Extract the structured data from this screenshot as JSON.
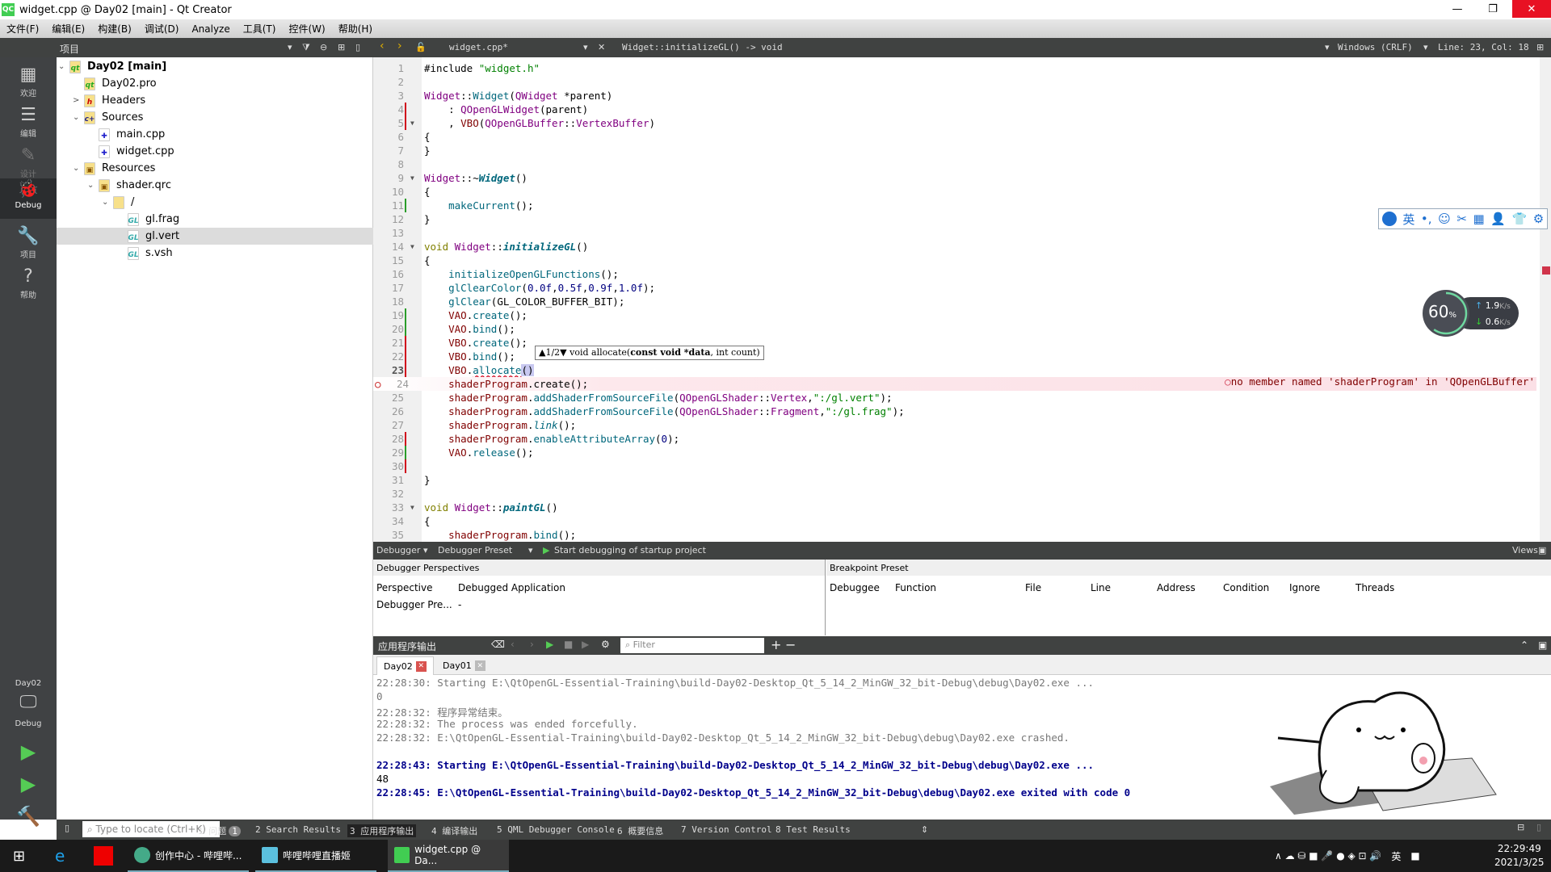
{
  "window": {
    "title": "widget.cpp @ Day02 [main] - Qt Creator",
    "logo": "QC"
  },
  "menu": [
    "文件(F)",
    "编辑(E)",
    "构建(B)",
    "调试(D)",
    "Analyze",
    "工具(T)",
    "控件(W)",
    "帮助(H)"
  ],
  "toolbar": {
    "projects_label": "项目",
    "file": "widget.cpp*",
    "symbol": "Widget::initializeGL() -> void",
    "encoding": "Windows (CRLF)",
    "position": "Line: 23, Col: 18"
  },
  "modes": [
    {
      "label": "欢迎",
      "icon": "grid-icon"
    },
    {
      "label": "编辑",
      "icon": "edit-icon"
    },
    {
      "label": "设计",
      "icon": "pencil-icon"
    },
    {
      "label": "Debug",
      "icon": "bug-icon"
    },
    {
      "label": "项目",
      "icon": "wrench-icon"
    },
    {
      "label": "帮助",
      "icon": "help-icon"
    }
  ],
  "kit": {
    "project": "Day02",
    "mode": "Debug"
  },
  "tree": [
    {
      "label": "Day02 [main]",
      "depth": 0,
      "chev": "v",
      "icon": "qt",
      "bold": true
    },
    {
      "label": "Day02.pro",
      "depth": 1,
      "chev": "",
      "icon": "qt"
    },
    {
      "label": "Headers",
      "depth": 1,
      "chev": ">",
      "icon": "h"
    },
    {
      "label": "Sources",
      "depth": 1,
      "chev": "v",
      "icon": "c++"
    },
    {
      "label": "main.cpp",
      "depth": 2,
      "chev": "",
      "icon": "cpp"
    },
    {
      "label": "widget.cpp",
      "depth": 2,
      "chev": "",
      "icon": "cpp"
    },
    {
      "label": "Resources",
      "depth": 1,
      "chev": "v",
      "icon": "res"
    },
    {
      "label": "shader.qrc",
      "depth": 2,
      "chev": "v",
      "icon": "res"
    },
    {
      "label": "/",
      "depth": 3,
      "chev": "v",
      "icon": "folder"
    },
    {
      "label": "gl.frag",
      "depth": 4,
      "chev": "",
      "icon": "gl"
    },
    {
      "label": "gl.vert",
      "depth": 4,
      "chev": "",
      "icon": "gl",
      "selected": true
    },
    {
      "label": "s.vsh",
      "depth": 4,
      "chev": "",
      "icon": "gl"
    }
  ],
  "editor": {
    "current_line": 23,
    "breakpoint_line": 24,
    "error_line": 24,
    "error_message": "no member named 'shaderProgram' in 'QOpenGLBuffer'",
    "tooltip": {
      "counter": "1/2",
      "prefix": "void allocate(",
      "bold": "const void *data",
      "suffix": ", int count)"
    },
    "changed_red": [
      4,
      5,
      21,
      22,
      23,
      28,
      30
    ],
    "changed_green": [
      11,
      19,
      20,
      29
    ],
    "folds": [
      5,
      9,
      14,
      33
    ],
    "lines": [
      [
        [
          "#include ",
          ""
        ],
        [
          "\"widget.h\"",
          "s"
        ]
      ],
      [],
      [
        [
          "Widget",
          "ty"
        ],
        [
          "::",
          ""
        ],
        [
          "Widget",
          "f"
        ],
        [
          "(",
          ""
        ],
        [
          "QWidget",
          "ty"
        ],
        [
          " *parent)",
          ""
        ]
      ],
      [
        [
          "    : ",
          ""
        ],
        [
          "QOpenGLWidget",
          "ty"
        ],
        [
          "(parent)",
          ""
        ]
      ],
      [
        [
          "    , ",
          ""
        ],
        [
          "VBO",
          "m"
        ],
        [
          "(",
          ""
        ],
        [
          "QOpenGLBuffer",
          "ty"
        ],
        [
          "::",
          ""
        ],
        [
          "VertexBuffer",
          "ty"
        ],
        [
          ")",
          ""
        ]
      ],
      [
        [
          "{",
          ""
        ]
      ],
      [
        [
          "}",
          ""
        ]
      ],
      [],
      [
        [
          "Widget",
          "ty"
        ],
        [
          "::~",
          ""
        ],
        [
          "Widget",
          "fi"
        ],
        [
          "()",
          ""
        ]
      ],
      [
        [
          "{",
          ""
        ]
      ],
      [
        [
          "    ",
          ""
        ],
        [
          "makeCurrent",
          "f"
        ],
        [
          "();",
          ""
        ]
      ],
      [
        [
          "}",
          ""
        ]
      ],
      [],
      [
        [
          "void ",
          "k"
        ],
        [
          "Widget",
          "ty"
        ],
        [
          "::",
          ""
        ],
        [
          "initializeGL",
          "fi"
        ],
        [
          "()",
          ""
        ]
      ],
      [
        [
          "{",
          ""
        ]
      ],
      [
        [
          "    ",
          ""
        ],
        [
          "initializeOpenGLFunctions",
          "f"
        ],
        [
          "();",
          ""
        ]
      ],
      [
        [
          "    ",
          ""
        ],
        [
          "glClearColor",
          "f"
        ],
        [
          "(",
          ""
        ],
        [
          "0.0f",
          "n"
        ],
        [
          ",",
          ""
        ],
        [
          "0.5f",
          "n"
        ],
        [
          ",",
          ""
        ],
        [
          "0.9f",
          "n"
        ],
        [
          ",",
          ""
        ],
        [
          "1.0f",
          "n"
        ],
        [
          ");",
          ""
        ]
      ],
      [
        [
          "    ",
          ""
        ],
        [
          "glClear",
          "f"
        ],
        [
          "(GL_COLOR_BUFFER_BIT);",
          ""
        ]
      ],
      [
        [
          "    ",
          ""
        ],
        [
          "VAO",
          "m"
        ],
        [
          ".",
          ""
        ],
        [
          "create",
          "f"
        ],
        [
          "();",
          ""
        ]
      ],
      [
        [
          "    ",
          ""
        ],
        [
          "VAO",
          "m"
        ],
        [
          ".",
          ""
        ],
        [
          "bind",
          "f"
        ],
        [
          "();",
          ""
        ]
      ],
      [
        [
          "    ",
          ""
        ],
        [
          "VBO",
          "m"
        ],
        [
          ".",
          ""
        ],
        [
          "create",
          "f"
        ],
        [
          "();",
          ""
        ]
      ],
      [
        [
          "    ",
          ""
        ],
        [
          "VBO",
          "m"
        ],
        [
          ".",
          ""
        ],
        [
          "bind",
          "f"
        ],
        [
          "();",
          ""
        ]
      ],
      [
        [
          "    ",
          ""
        ],
        [
          "VBO",
          "m"
        ],
        [
          ".",
          ""
        ],
        [
          "allocate",
          "f"
        ],
        [
          "()",
          ""
        ]
      ],
      [
        [
          "    ",
          ""
        ],
        [
          "shaderProgram",
          "m"
        ],
        [
          ".create();",
          ""
        ]
      ],
      [
        [
          "    ",
          ""
        ],
        [
          "shaderProgram",
          "m"
        ],
        [
          ".",
          ""
        ],
        [
          "addShaderFromSourceFile",
          "f"
        ],
        [
          "(",
          ""
        ],
        [
          "QOpenGLShader",
          "ty"
        ],
        [
          "::",
          ""
        ],
        [
          "Vertex",
          "ty"
        ],
        [
          ",",
          ""
        ],
        [
          "\":/gl.vert\"",
          "s"
        ],
        [
          ");",
          ""
        ]
      ],
      [
        [
          "    ",
          ""
        ],
        [
          "shaderProgram",
          "m"
        ],
        [
          ".",
          ""
        ],
        [
          "addShaderFromSourceFile",
          "f"
        ],
        [
          "(",
          ""
        ],
        [
          "QOpenGLShader",
          "ty"
        ],
        [
          "::",
          ""
        ],
        [
          "Fragment",
          "ty"
        ],
        [
          ",",
          ""
        ],
        [
          "\":/gl.frag\"",
          "s"
        ],
        [
          ");",
          ""
        ]
      ],
      [
        [
          "    ",
          ""
        ],
        [
          "shaderProgram",
          "m"
        ],
        [
          ".",
          ""
        ],
        [
          "link",
          "vi"
        ],
        [
          "();",
          ""
        ]
      ],
      [
        [
          "    ",
          ""
        ],
        [
          "shaderProgram",
          "m"
        ],
        [
          ".",
          ""
        ],
        [
          "enableAttributeArray",
          "f"
        ],
        [
          "(",
          ""
        ],
        [
          "0",
          "n"
        ],
        [
          ");",
          ""
        ]
      ],
      [
        [
          "    ",
          ""
        ],
        [
          "VAO",
          "m"
        ],
        [
          ".",
          ""
        ],
        [
          "release",
          "f"
        ],
        [
          "();",
          ""
        ]
      ],
      [],
      [
        [
          "}",
          ""
        ]
      ],
      [],
      [
        [
          "void ",
          "k"
        ],
        [
          "Widget",
          "ty"
        ],
        [
          "::",
          ""
        ],
        [
          "paintGL",
          "fi"
        ],
        [
          "()",
          ""
        ]
      ],
      [
        [
          "{",
          ""
        ]
      ],
      [
        [
          "    ",
          ""
        ],
        [
          "shaderProgram",
          "m"
        ],
        [
          ".",
          ""
        ],
        [
          "bind",
          "f"
        ],
        [
          "();",
          ""
        ]
      ]
    ]
  },
  "ime": [
    "英",
    "•,",
    "☺",
    "✂",
    "▦",
    "👤",
    "👕",
    "⚙"
  ],
  "net": {
    "percent": "60",
    "percent_sign": "%",
    "up": "1.9",
    "down": "0.6",
    "unit": "K/s",
    "level": 0.6
  },
  "debugger": {
    "debugger": "Debugger",
    "preset": "Debugger Preset",
    "start": "Start debugging of startup project",
    "views": "Views",
    "perspectives_title": "Debugger Perspectives",
    "perspective_cols": [
      "Perspective",
      "Debugged Application"
    ],
    "perspective_row": [
      "Debugger Pre...",
      "-"
    ],
    "breakpoint_title": "Breakpoint Preset",
    "breakpoint_cols": [
      "Debuggee",
      "Function",
      "File",
      "Line",
      "Address",
      "Condition",
      "Ignore",
      "Threads"
    ]
  },
  "output": {
    "title": "应用程序输出",
    "filter_placeholder": "Filter",
    "tabs": [
      {
        "label": "Day02",
        "active": true
      },
      {
        "label": "Day01",
        "active": false
      }
    ],
    "lines": [
      {
        "text": "22:28:30: Starting E:\\QtOpenGL-Essential-Training\\build-Day02-Desktop_Qt_5_14_2_MinGW_32_bit-Debug\\debug\\Day02.exe ...",
        "style": "gray"
      },
      {
        "text": "0",
        "style": "gray"
      },
      {
        "text": "22:28:32: 程序异常结束。",
        "style": "gray"
      },
      {
        "text": "22:28:32: The process was ended forcefully.",
        "style": "gray"
      },
      {
        "text": "22:28:32: E:\\QtOpenGL-Essential-Training\\build-Day02-Desktop_Qt_5_14_2_MinGW_32_bit-Debug\\debug\\Day02.exe crashed.",
        "style": "gray"
      },
      {
        "text": "",
        "style": "gray"
      },
      {
        "text": "22:28:43: Starting E:\\QtOpenGL-Essential-Training\\build-Day02-Desktop_Qt_5_14_2_MinGW_32_bit-Debug\\debug\\Day02.exe ...",
        "style": "blue"
      },
      {
        "text": "48",
        "style": "black"
      },
      {
        "text": "22:28:45: E:\\QtOpenGL-Essential-Training\\build-Day02-Desktop_Qt_5_14_2_MinGW_32_bit-Debug\\debug\\Day02.exe exited with code 0",
        "style": "blue"
      }
    ]
  },
  "status": {
    "locate_placeholder": "Type to locate (Ctrl+K)",
    "panes": [
      "1 问题",
      "2 Search Results",
      "3 应用程序输出",
      "4 编译输出",
      "5 QML Debugger Console",
      "6 概要信息",
      "7 Version Control",
      "8 Test Results"
    ],
    "issues_count": "1",
    "active_pane": 2
  },
  "taskbar": {
    "apps": [
      "创作中心 - 哔哩哔...",
      "哔哩哔哩直播姬",
      "widget.cpp @ Da..."
    ],
    "time": "22:29:49",
    "date": "2021/3/25",
    "ime": "英"
  },
  "colors": {
    "accent_green": "#41cd52",
    "error": "#800000",
    "change_red": "#d0021b",
    "change_green": "#2a9d2a",
    "dark_panel": "#404241"
  }
}
